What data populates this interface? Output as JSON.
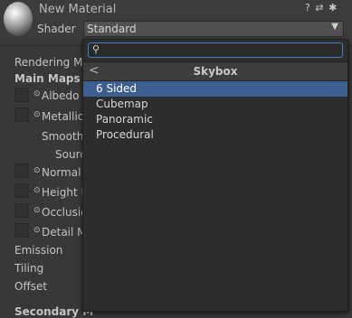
{
  "header": {
    "material_name": "New Material",
    "icons": [
      "help-icon",
      "preset-icon",
      "settings-icon"
    ],
    "help_glyph": "?",
    "preset_glyph": "⇄",
    "settings_glyph": "✱",
    "shader_label": "Shader",
    "shader_value": "Standard"
  },
  "inspector": {
    "rendering_mode": "Rendering Mo",
    "main_maps": "Main Maps",
    "albedo": "Albedo",
    "metallic": "Metallic",
    "smoothness": "Smoothn",
    "source": "Sourc",
    "normal": "Normal I",
    "height": "Height M",
    "occlusion": "Occlusio",
    "detail": "Detail M",
    "emission": "Emission",
    "tiling": "Tiling",
    "offset": "Offset",
    "secondary_maps": "Secondary M"
  },
  "popup": {
    "search_value": "",
    "category_title": "Skybox",
    "back_glyph": "<",
    "items": [
      "6 Sided",
      "Cubemap",
      "Panoramic",
      "Procedural"
    ],
    "selected_index": 0
  },
  "colors": {
    "background": "#383838",
    "selection": "#3d5f8f",
    "search_focus": "#3f7fbf"
  }
}
